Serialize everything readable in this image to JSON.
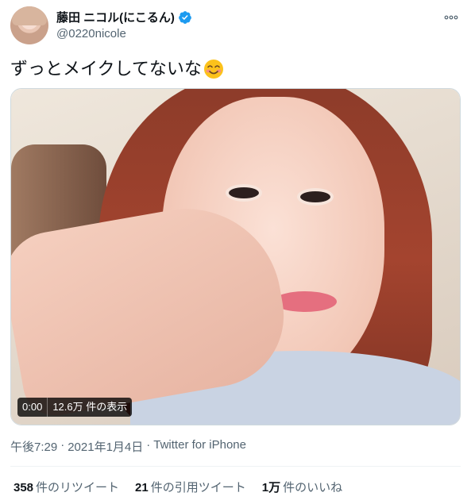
{
  "user": {
    "display_name": "藤田 ニコル(にこるん)",
    "handle": "@0220nicole",
    "verified": true
  },
  "tweet": {
    "text": "ずっとメイクしてないな",
    "emoji": "smiling-face-with-smiling-eyes-icon"
  },
  "video": {
    "time": "0:00",
    "views": "12.6万 件の表示"
  },
  "meta": {
    "time": "午後7:29",
    "sep1": "·",
    "date": "2021年1月4日",
    "sep2": "·",
    "source": "Twitter for iPhone"
  },
  "stats": [
    {
      "num": "358",
      "label": "件のリツイート"
    },
    {
      "num": "21",
      "label": "件の引用ツイート"
    },
    {
      "num": "1万",
      "label": "件のいいね"
    }
  ],
  "colors": {
    "verified": "#1d9bf0",
    "text": "#0f1419",
    "secondary": "#536471"
  }
}
